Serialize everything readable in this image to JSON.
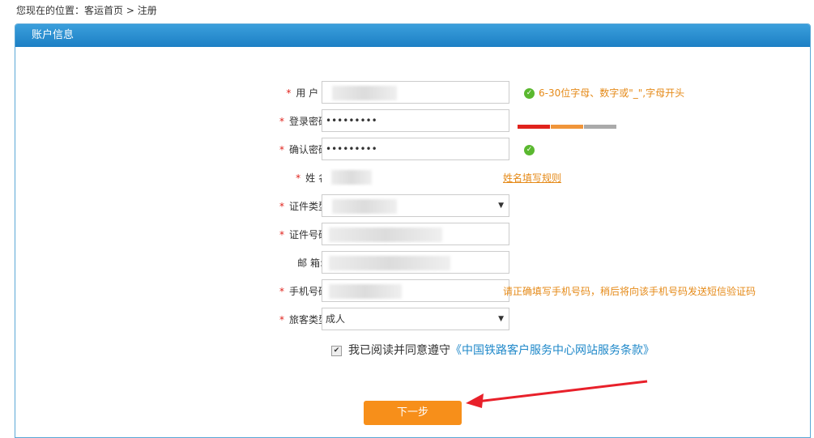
{
  "breadcrumb": {
    "prefix": "您现在的位置：",
    "home": "客运首页",
    "sep": " > ",
    "current": "注册"
  },
  "panel": {
    "title": "账户信息"
  },
  "form": {
    "username_label": "用 户 名",
    "password_label": "登录密码:",
    "password_value": "•••••••••",
    "confirm_label": "确认密码:",
    "confirm_value": "•••••••••",
    "name_label": "姓 名:",
    "idtype_label": "证件类型:",
    "idnum_label": "证件号码:",
    "email_label": "邮 箱:",
    "phone_label": "手机号码:",
    "passenger_label": "旅客类型:",
    "passenger_value": "成人"
  },
  "tips": {
    "username": "6-30位字母、数字或\"_\",字母开头",
    "name_rule": "姓名填写规则",
    "phone": "请正确填写手机号码，稍后将向该手机号码发送短信验证码"
  },
  "agreement": {
    "text": "我已阅读并同意遵守",
    "terms": "《中国铁路客户服务中心网站服务条款》",
    "checked_mark": "✔"
  },
  "button": {
    "next": "下一步"
  },
  "colors": {
    "accent": "#f78f1a",
    "header": "#1c7fc4",
    "required": "#e0231c",
    "tip": "#e58a18"
  }
}
